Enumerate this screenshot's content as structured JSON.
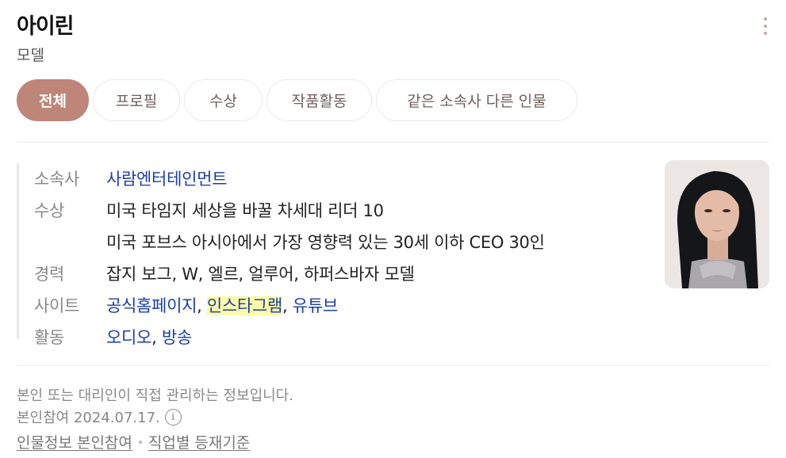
{
  "header": {
    "name": "아이린",
    "occupation": "모델"
  },
  "tabs": [
    {
      "label": "전체",
      "active": true
    },
    {
      "label": "프로필",
      "active": false
    },
    {
      "label": "수상",
      "active": false
    },
    {
      "label": "작품활동",
      "active": false
    },
    {
      "label": "같은 소속사 다른 인물",
      "active": false
    }
  ],
  "profile": {
    "agency_label": "소속사",
    "agency_value": "사람엔터테인먼트",
    "awards_label": "수상",
    "awards": [
      "미국 타임지 세상을 바꿀 차세대 리더 10",
      "미국 포브스 아시아에서 가장 영향력 있는 30세 이하 CEO 30인"
    ],
    "career_label": "경력",
    "career_value": "잡지 보그, W, 엘르, 얼루어, 하퍼스바자 모델",
    "sites_label": "사이트",
    "sites": [
      "공식홈페이지",
      "인스타그램",
      "유튜브"
    ],
    "activity_label": "활동",
    "activities": [
      "오디오",
      "방송"
    ],
    "separator": ","
  },
  "footer": {
    "notice": "본인 또는 대리인이 직접 관리하는 정보입니다.",
    "participation": "본인참여 2024.07.17.",
    "info_glyph": "i",
    "links": [
      "인물정보 본인참여",
      "직업별 등재기준"
    ]
  },
  "colors": {
    "accent": "#be8679",
    "link": "#1a3ea6",
    "highlight": "#fdfaa8"
  }
}
